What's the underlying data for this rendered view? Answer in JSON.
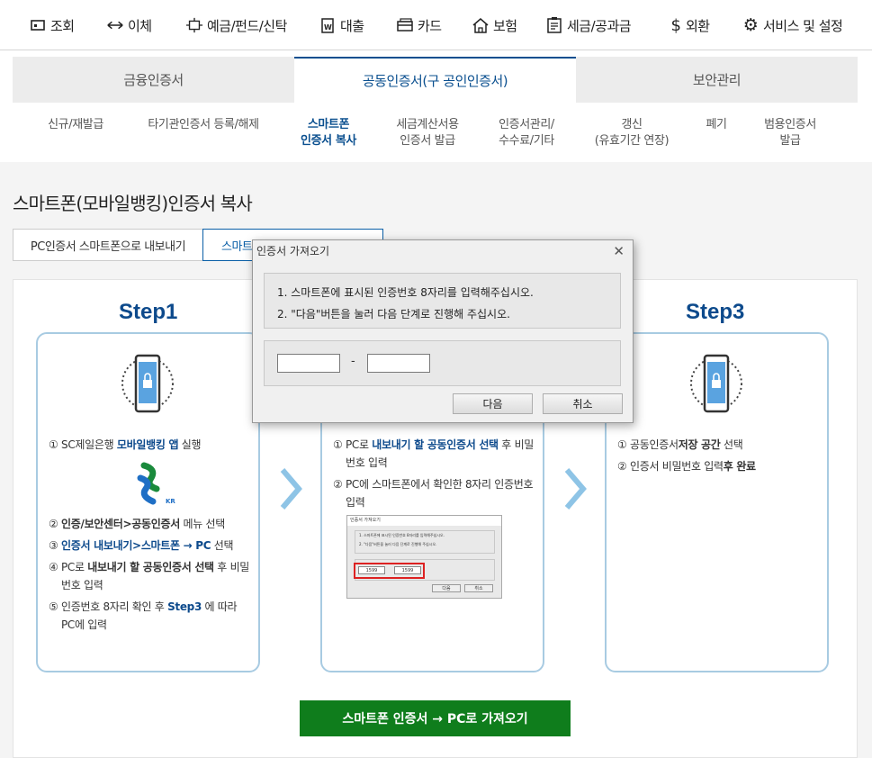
{
  "nav": [
    {
      "label": "조회",
      "icon": "inquiry-icon"
    },
    {
      "label": "이체",
      "icon": "transfer-icon"
    },
    {
      "label": "예금/펀드/신탁",
      "icon": "deposit-icon"
    },
    {
      "label": "대출",
      "icon": "loan-icon"
    },
    {
      "label": "카드",
      "icon": "card-icon"
    },
    {
      "label": "보험",
      "icon": "insurance-icon"
    },
    {
      "label": "세금/공과금",
      "icon": "tax-icon"
    },
    {
      "label": "외환",
      "icon": "dollar-icon"
    },
    {
      "label": "서비스 및 설정",
      "icon": "gear-icon"
    }
  ],
  "tabs": [
    "금융인증서",
    "공동인증서(구 공인인증서)",
    "보안관리"
  ],
  "active_tab": 1,
  "subtabs": [
    "신규/재발급",
    "타기관인증서 등록/해제",
    "스마트폰\n인증서 복사",
    "세금계산서용\n인증서 발급",
    "인증서관리/\n수수료/기타",
    "갱신\n(유효기간 연장)",
    "폐기",
    "범용인증서\n발급"
  ],
  "active_subtab": 2,
  "page_title": "스마트폰(모바일뱅킹)인증서 복사",
  "mode_tabs": [
    "PC인증서 스마트폰으로 내보내기",
    "스마트폰"
  ],
  "step1": {
    "title": "Step1",
    "lines": [
      [
        "①",
        "SC제일은행 ",
        "모바일뱅킹 앱",
        " 실행"
      ],
      [
        "②",
        "인증/보안센터>공동인증서",
        " 메뉴 선택",
        ""
      ],
      [
        "③",
        "인증서 내보내기>스마트폰 → PC",
        " 선택",
        ""
      ],
      [
        "④",
        "PC로 ",
        "내보내기 할 공동인증서 선택",
        " 후 비밀번호 입력"
      ],
      [
        "⑤",
        "인증번호 8자리 확인 후 ",
        "Step3",
        " 에 따라 PC에 입력"
      ]
    ]
  },
  "step2": {
    "lines": [
      [
        "①",
        "PC로 ",
        "내보내기 할 공동인증서 선택",
        " 후 비밀번호 입력"
      ],
      [
        "②",
        "PC에 스마트폰에서 확인한 8자리 인증번호 입력",
        "",
        ""
      ]
    ]
  },
  "step3": {
    "title": "Step3",
    "lines": [
      [
        "①",
        "공동인증서",
        "저장 공간",
        " 선택"
      ],
      [
        "②",
        "인증서 비밀번호 입력",
        "후 완료",
        ""
      ]
    ]
  },
  "logo_text": "KR",
  "mini_dialog": {
    "title": "인증서 가져오기",
    "line1": "1. 스마트폰에 표시된 인증번호 8자리를 입력해주십시오.",
    "line2": "2. \"다음\"버튼을 눌러 다음 단계로 진행해 주십시오.",
    "code1": "1599",
    "code2": "1599",
    "next": "다음",
    "cancel": "취소"
  },
  "main_button": "스마트폰 인증서 → PC로 가져오기",
  "dialog": {
    "title": "인증서 가져오기",
    "close": "✕",
    "line1": "1. 스마트폰에 표시된 인증번호 8자리를 입력해주십시오.",
    "line2": "2. \"다음\"버튼을 눌러 다음 단계로 진행해 주십시오.",
    "dash": "-",
    "input1": "",
    "input2": "",
    "next": "다음",
    "cancel": "취소"
  },
  "colors": {
    "brand": "#0a4f8f",
    "green": "#0f7d1c",
    "card_border": "#a8cbe2"
  }
}
